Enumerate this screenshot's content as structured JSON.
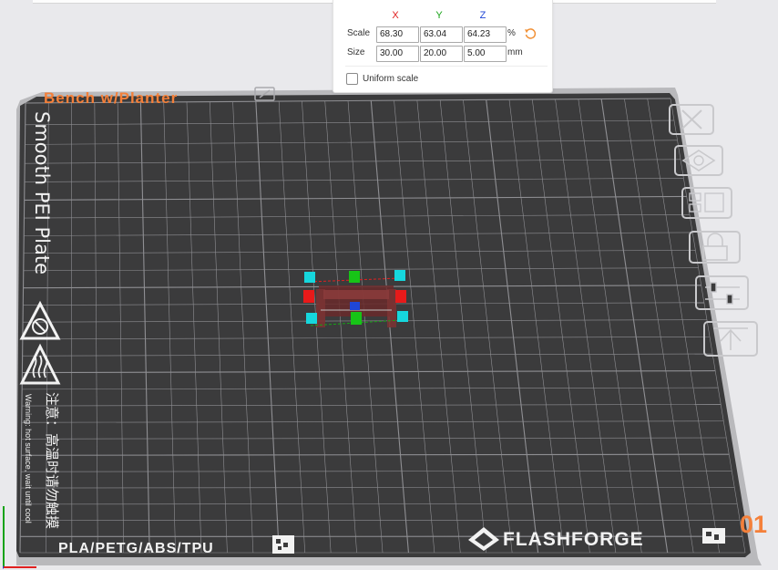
{
  "plate": {
    "name": "Bench w/Planter",
    "surface": "Smooth PEI Plate",
    "warning_cn": "注意：高温时请勿触摸",
    "warning_en": "Warning: hot surface, wait until cool",
    "materials": "PLA/PETG/ABS/TPU",
    "brand": "FLASHFORGE",
    "plate_number": "01"
  },
  "scale_panel": {
    "headers": {
      "x": "X",
      "y": "Y",
      "z": "Z"
    },
    "scale_label": "Scale",
    "size_label": "Size",
    "scale": {
      "x": "68.30",
      "y": "63.04",
      "z": "64.23"
    },
    "size": {
      "x": "30.00",
      "y": "20.00",
      "z": "5.00"
    },
    "scale_unit": "%",
    "size_unit": "mm",
    "uniform_scale_label": "Uniform scale",
    "uniform_scale_checked": false
  },
  "side_toolbar": [
    {
      "name": "delete-plate-button",
      "icon": "close-icon"
    },
    {
      "name": "auto-orient-button",
      "icon": "auto-orient-icon"
    },
    {
      "name": "arrange-button",
      "icon": "arrange-icon"
    },
    {
      "name": "lock-button",
      "icon": "lock-icon"
    },
    {
      "name": "plate-settings-button",
      "icon": "sliders-icon"
    },
    {
      "name": "move-to-top-button",
      "icon": "move-to-top-icon"
    }
  ],
  "colors": {
    "axis_x": "#e02020",
    "axis_y": "#17a317",
    "axis_z": "#1f46d6",
    "plate": "#3c3c3c",
    "plate_edge": "#b8b8bb",
    "plate_name": "#f4803a",
    "plate_number": "#f4803a",
    "handle_corner": "#16d7dd",
    "reset": "#f19035"
  }
}
